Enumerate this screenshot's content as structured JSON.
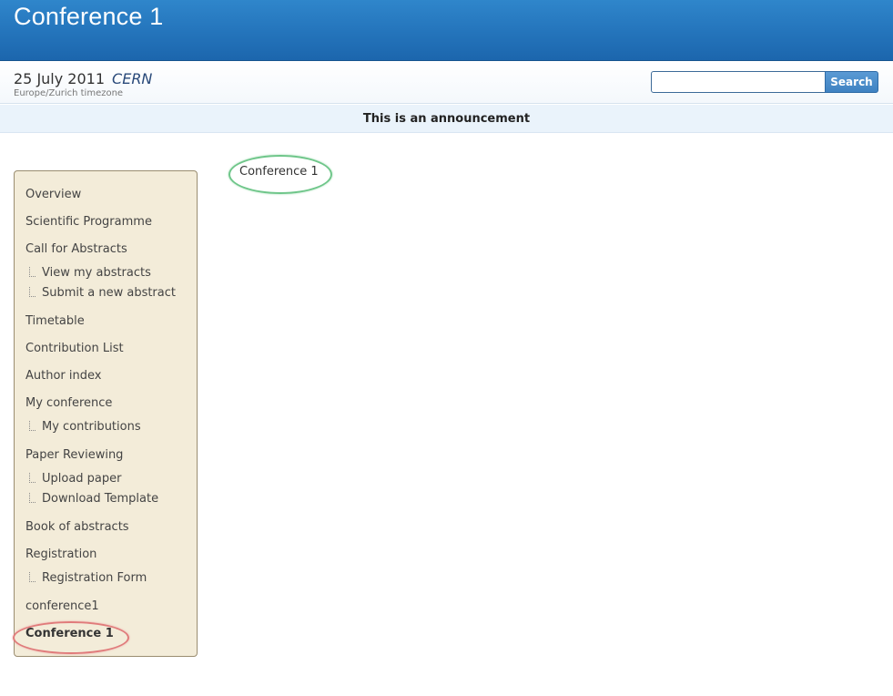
{
  "banner": {
    "title": "Conference 1"
  },
  "subheader": {
    "date": "25 July 2011",
    "location": "CERN",
    "timezone": "Europe/Zurich timezone"
  },
  "search": {
    "value": "",
    "button_label": "Search"
  },
  "announcement": "This is an announcement",
  "breadcrumb": "Conference 1",
  "menu": {
    "overview": "Overview",
    "scientific_programme": "Scientific Programme",
    "call_for_abstracts": "Call for Abstracts",
    "view_my_abstracts": "View my abstracts",
    "submit_new_abstract": "Submit a new abstract",
    "timetable": "Timetable",
    "contribution_list": "Contribution List",
    "author_index": "Author index",
    "my_conference": "My conference",
    "my_contributions": "My contributions",
    "paper_reviewing": "Paper Reviewing",
    "upload_paper": "Upload paper",
    "download_template": "Download Template",
    "book_of_abstracts": "Book of abstracts",
    "registration": "Registration",
    "registration_form": "Registration Form",
    "conference1": "conference1",
    "conference_1": "Conference 1"
  },
  "colors": {
    "banner": "#2474bb",
    "menu_bg": "#f3ecd9",
    "highlight_red": "#e07b7b",
    "highlight_green": "#6fc68a"
  }
}
